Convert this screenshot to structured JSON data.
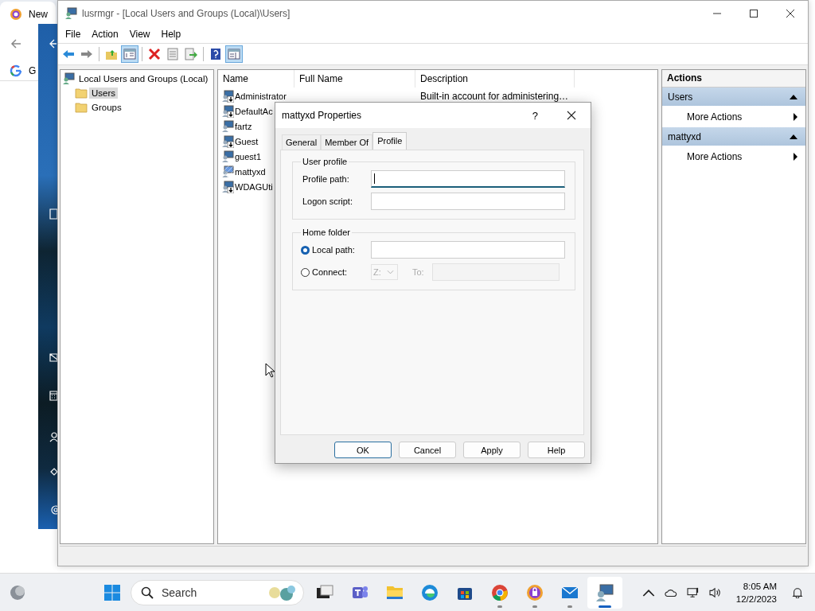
{
  "browser": {
    "tab_title": "New",
    "bookmark": "G"
  },
  "window": {
    "title": "lusrmgr - [Local Users and Groups (Local)\\Users]"
  },
  "menu": [
    "File",
    "Action",
    "View",
    "Help"
  ],
  "toolbar": [
    {
      "kind": "back",
      "pressed": false
    },
    {
      "kind": "forward",
      "pressed": false
    },
    {
      "kind": "separator"
    },
    {
      "kind": "up",
      "pressed": false
    },
    {
      "kind": "tree",
      "pressed": true
    },
    {
      "kind": "separator"
    },
    {
      "kind": "delete",
      "pressed": false
    },
    {
      "kind": "properties",
      "pressed": false
    },
    {
      "kind": "export",
      "pressed": false
    },
    {
      "kind": "separator"
    },
    {
      "kind": "help",
      "pressed": false
    },
    {
      "kind": "actionpane",
      "pressed": true
    }
  ],
  "tree": {
    "label": "Local Users and Groups (Local)",
    "children": [
      {
        "label": "Users",
        "selected": true
      },
      {
        "label": "Groups",
        "selected": false
      }
    ]
  },
  "list": {
    "columns": [
      "Name",
      "Full Name",
      "Description"
    ],
    "rows": [
      {
        "name": "Administrator",
        "description": "Built-in account for administering…",
        "disabled": true,
        "selected": false
      },
      {
        "name": "DefaultAc",
        "disabled": true,
        "selected": false
      },
      {
        "name": "fartz",
        "disabled": false,
        "selected": false
      },
      {
        "name": "Guest",
        "disabled": true,
        "selected": false
      },
      {
        "name": "guest1",
        "disabled": false,
        "selected": false
      },
      {
        "name": "mattyxd",
        "disabled": false,
        "selected": true
      },
      {
        "name": "WDAGUti",
        "disabled": true,
        "selected": false
      }
    ]
  },
  "actions": {
    "title": "Actions",
    "sections": [
      {
        "title": "Users",
        "expanded": true,
        "items": [
          "More Actions"
        ]
      },
      {
        "title": "mattyxd",
        "expanded": true,
        "items": [
          "More Actions"
        ]
      }
    ]
  },
  "dialog": {
    "title": "mattyxd Properties",
    "help": "?",
    "tabs": [
      {
        "label": "General",
        "selected": false
      },
      {
        "label": "Member Of",
        "selected": false
      },
      {
        "label": "Profile",
        "selected": true
      }
    ],
    "user_profile": {
      "title": "User profile",
      "fields": [
        {
          "label": "Profile path:",
          "focused": true
        },
        {
          "label": "Logon script:",
          "focused": false
        }
      ]
    },
    "home_folder": {
      "title": "Home folder",
      "local_path": {
        "label": "Local path:",
        "selected": true
      },
      "connect": {
        "label": "Connect:",
        "selected": false,
        "drive": "Z:",
        "to_label": "To:"
      }
    },
    "buttons": [
      {
        "label": "OK",
        "default": true
      },
      {
        "label": "Cancel",
        "default": false
      },
      {
        "label": "Apply",
        "default": false
      },
      {
        "label": "Help",
        "default": false
      }
    ]
  },
  "taskbar": {
    "search_placeholder": "Search",
    "time": "8:05 AM",
    "date": "12/2/2023",
    "apps": [
      {
        "kind": "taskview",
        "running": false,
        "active": false
      },
      {
        "kind": "teams",
        "running": false,
        "active": false
      },
      {
        "kind": "explorer",
        "running": false,
        "active": false
      },
      {
        "kind": "edge",
        "running": false,
        "active": false
      },
      {
        "kind": "store",
        "running": false,
        "active": false
      },
      {
        "kind": "chrome",
        "running": true,
        "active": false
      },
      {
        "kind": "vpn",
        "running": true,
        "active": false
      },
      {
        "kind": "mail",
        "running": true,
        "active": false
      },
      {
        "kind": "mmc",
        "running": true,
        "active": true
      }
    ]
  }
}
